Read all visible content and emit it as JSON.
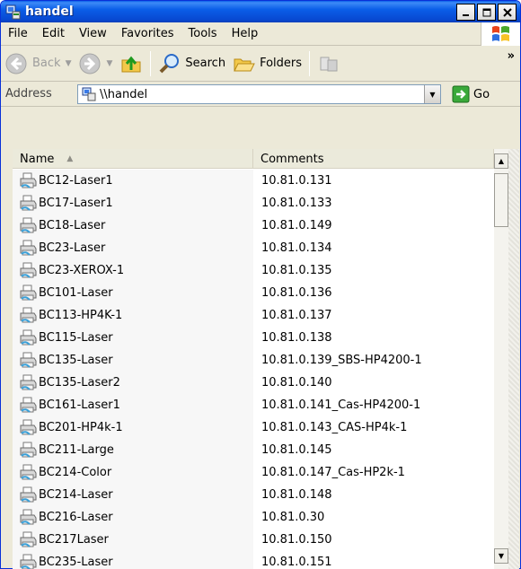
{
  "window": {
    "title": "handel"
  },
  "menu": {
    "items": [
      "File",
      "Edit",
      "View",
      "Favorites",
      "Tools",
      "Help"
    ]
  },
  "toolbar": {
    "back_label": "Back",
    "search_label": "Search",
    "folders_label": "Folders"
  },
  "address": {
    "label": "Address",
    "value": "\\\\handel",
    "go_label": "Go"
  },
  "list": {
    "columns": [
      "Name",
      "Comments"
    ],
    "rows": [
      {
        "name": "BC12-Laser1",
        "comment": "10.81.0.131"
      },
      {
        "name": "BC17-Laser1",
        "comment": "10.81.0.133"
      },
      {
        "name": "BC18-Laser",
        "comment": "10.81.0.149"
      },
      {
        "name": "BC23-Laser",
        "comment": "10.81.0.134"
      },
      {
        "name": "BC23-XEROX-1",
        "comment": "10.81.0.135"
      },
      {
        "name": "BC101-Laser",
        "comment": "10.81.0.136"
      },
      {
        "name": "BC113-HP4K-1",
        "comment": "10.81.0.137"
      },
      {
        "name": "BC115-Laser",
        "comment": "10.81.0.138"
      },
      {
        "name": "BC135-Laser",
        "comment": "10.81.0.139_SBS-HP4200-1"
      },
      {
        "name": "BC135-Laser2",
        "comment": "10.81.0.140"
      },
      {
        "name": "BC161-Laser1",
        "comment": "10.81.0.141_Cas-HP4200-1"
      },
      {
        "name": "BC201-HP4k-1",
        "comment": "10.81.0.143_CAS-HP4k-1"
      },
      {
        "name": "BC211-Large",
        "comment": "10.81.0.145"
      },
      {
        "name": "BC214-Color",
        "comment": "10.81.0.147_Cas-HP2k-1"
      },
      {
        "name": "BC214-Laser",
        "comment": "10.81.0.148"
      },
      {
        "name": "BC216-Laser",
        "comment": "10.81.0.30"
      },
      {
        "name": "BC217Laser",
        "comment": "10.81.0.150"
      },
      {
        "name": "BC235-Laser",
        "comment": "10.81.0.151"
      }
    ]
  }
}
